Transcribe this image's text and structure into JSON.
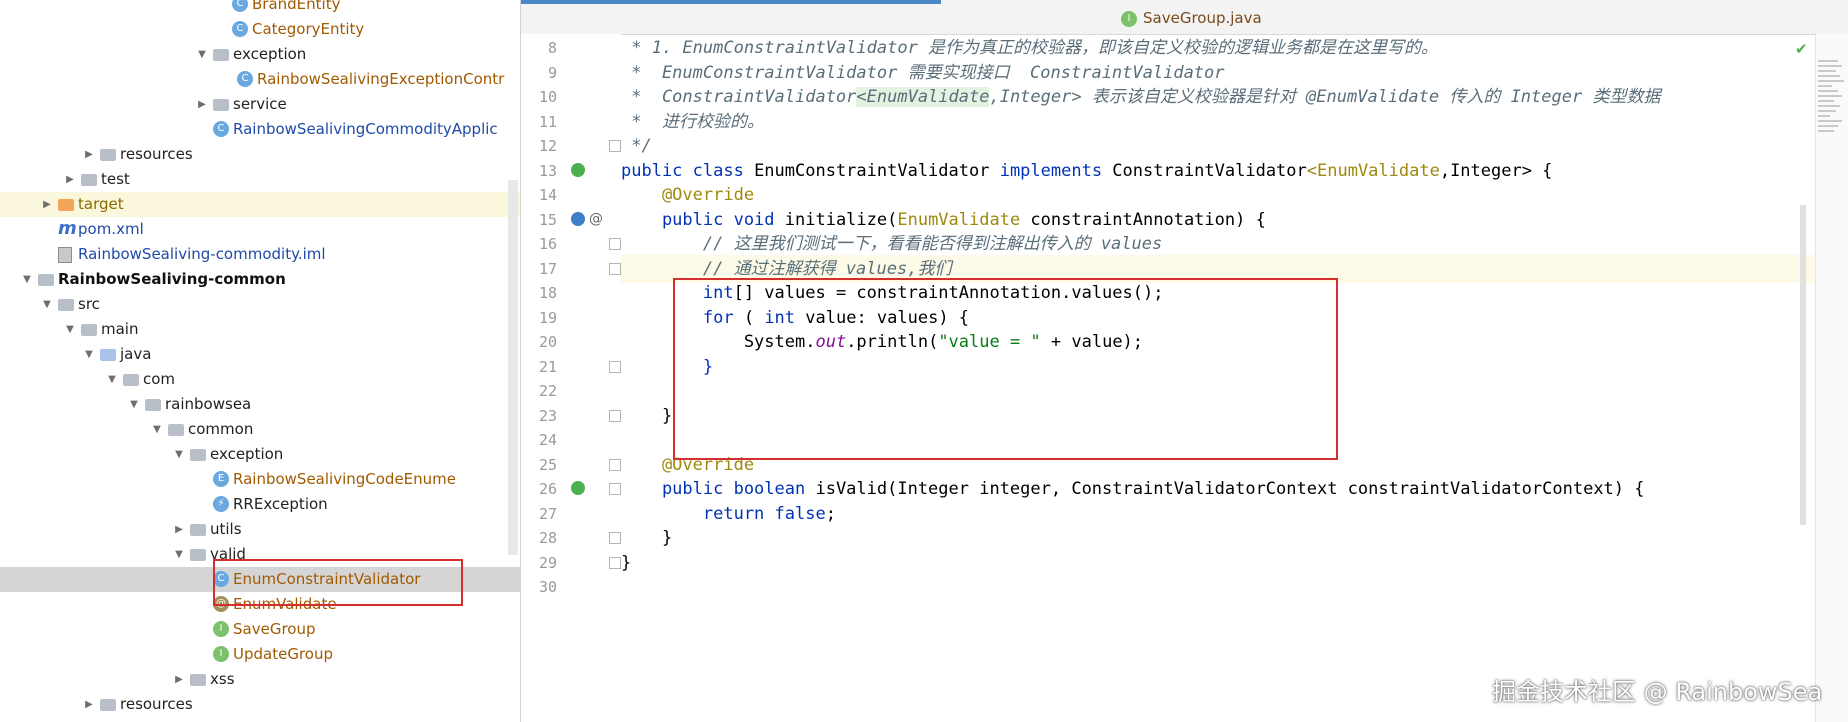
{
  "tree": [
    {
      "label": "BrandEntity",
      "depth": 0,
      "icon": "class",
      "color": "java",
      "indent": 252
    },
    {
      "label": "CategoryEntity",
      "depth": 0,
      "icon": "class",
      "color": "java",
      "indent": 252
    },
    {
      "label": "exception",
      "icon": "folder",
      "color": "plain",
      "indent": 233,
      "arrow": "down"
    },
    {
      "label": "RainbowSealivingExceptionContr",
      "icon": "class",
      "color": "java",
      "indent": 257
    },
    {
      "label": "service",
      "icon": "folder",
      "color": "plain",
      "indent": 233,
      "arrow": "right"
    },
    {
      "label": "RainbowSealivingCommodityApplic",
      "icon": "class",
      "color": "app",
      "indent": 233
    },
    {
      "label": "resources",
      "icon": "folder",
      "color": "plain",
      "indent": 120,
      "arrow": "right"
    },
    {
      "label": "test",
      "icon": "folder",
      "color": "plain",
      "indent": 101,
      "arrow": "right"
    },
    {
      "label": "target",
      "icon": "folder-orange",
      "color": "target",
      "indent": 78,
      "arrow": "right",
      "hl": true
    },
    {
      "label": "pom.xml",
      "icon": "pom",
      "color": "app",
      "indent": 78
    },
    {
      "label": "RainbowSealiving-commodity.iml",
      "icon": "file",
      "color": "iml",
      "indent": 78
    },
    {
      "label": "RainbowSealiving-common",
      "icon": "folder",
      "color": "bold",
      "indent": 58,
      "arrow": "down"
    },
    {
      "label": "src",
      "icon": "folder",
      "color": "plain",
      "indent": 78,
      "arrow": "down"
    },
    {
      "label": "main",
      "icon": "folder",
      "color": "plain",
      "indent": 101,
      "arrow": "down"
    },
    {
      "label": "java",
      "icon": "folder-src",
      "color": "plain",
      "indent": 120,
      "arrow": "down"
    },
    {
      "label": "com",
      "icon": "folder",
      "color": "plain",
      "indent": 143,
      "arrow": "down"
    },
    {
      "label": "rainbowsea",
      "icon": "folder",
      "color": "plain",
      "indent": 165,
      "arrow": "down"
    },
    {
      "label": "common",
      "icon": "folder",
      "color": "plain",
      "indent": 188,
      "arrow": "down"
    },
    {
      "label": "exception",
      "icon": "folder",
      "color": "plain",
      "indent": 210,
      "arrow": "down"
    },
    {
      "label": "RainbowSealivingCodeEnume",
      "icon": "enum",
      "color": "java",
      "indent": 233
    },
    {
      "label": "RRException",
      "icon": "exc",
      "color": "plain",
      "indent": 233
    },
    {
      "label": "utils",
      "icon": "folder",
      "color": "plain",
      "indent": 210,
      "arrow": "right"
    },
    {
      "label": "valid",
      "icon": "folder",
      "color": "plain",
      "indent": 210,
      "arrow": "down"
    },
    {
      "label": "EnumConstraintValidator",
      "icon": "class",
      "color": "java",
      "indent": 233,
      "sel": true
    },
    {
      "label": "EnumValidate",
      "icon": "annot",
      "color": "java",
      "indent": 233
    },
    {
      "label": "SaveGroup",
      "icon": "iface",
      "color": "java",
      "indent": 233
    },
    {
      "label": "UpdateGroup",
      "icon": "iface",
      "color": "java",
      "indent": 233
    },
    {
      "label": "xss",
      "icon": "folder",
      "color": "plain",
      "indent": 210,
      "arrow": "right"
    },
    {
      "label": "resources",
      "icon": "folder",
      "color": "plain",
      "indent": 120,
      "arrow": "right"
    }
  ],
  "tab": {
    "label": "SaveGroup.java",
    "icon": "interface-icon"
  },
  "line_numbers": [
    "8",
    "9",
    "10",
    "11",
    "12",
    "13",
    "14",
    "15",
    "16",
    "17",
    "18",
    "19",
    "20",
    "21",
    "22",
    "23",
    "24",
    "25",
    "26",
    "27",
    "28",
    "29",
    "30"
  ],
  "code": {
    "l8": " * 1. EnumConstraintValidator 是作为真正的校验器，即该自定义校验的逻辑业务都是在这里写的。",
    "l9": " *  EnumConstraintValidator 需要实现接口  ConstraintValidator",
    "l10a": " *  ConstraintValidator",
    "l10b": "<EnumValidate",
    "l10c": ",Integer> 表示该自定义校验器是针对 @EnumValidate 传入的 Integer 类型数据",
    "l11": " *  进行校验的。",
    "l12": " */",
    "l13_kw1": "public class ",
    "l13_name": "EnumConstraintValidator ",
    "l13_kw2": "implements ",
    "l13_rest": "ConstraintValidator",
    "l13_gen": "<EnumValidate",
    "l13_end": ",Integer> {",
    "l14": "    @Override",
    "l15_kw": "    public void ",
    "l15_rest": "initialize(",
    "l15_ann": "EnumValidate",
    "l15_end": " constraintAnnotation) {",
    "l16": "        // 这里我们测试一下，看看能否得到注解出传入的 values",
    "l17": "        // 通过注解获得 values,我们",
    "l18_kw": "        int",
    "l18_rest": "[] values = constraintAnnotation.values();",
    "l19_kw1": "        for",
    "l19_mid": " ( ",
    "l19_kw2": "int",
    "l19_end": " value: values) {",
    "l20_a": "            System.",
    "l20_fld": "out",
    "l20_b": ".println(",
    "l20_str": "\"value = \"",
    "l20_c": " + value);",
    "l21": "        }",
    "l23": "    }",
    "l25": "    @Override",
    "l26_kw": "    public boolean ",
    "l26_rest": "isValid(Integer integer, ConstraintValidatorContext constraintValidatorContext) {",
    "l27_kw": "        return false",
    "l27_end": ";",
    "l28": "    }",
    "l29": "}"
  },
  "watermark": "掘金技术社区 @ RainbowSea",
  "colors": {
    "highlight_box": "#d32f2f",
    "keyword": "#0033b3",
    "annotation": "#9e880d",
    "string": "#067d17"
  }
}
